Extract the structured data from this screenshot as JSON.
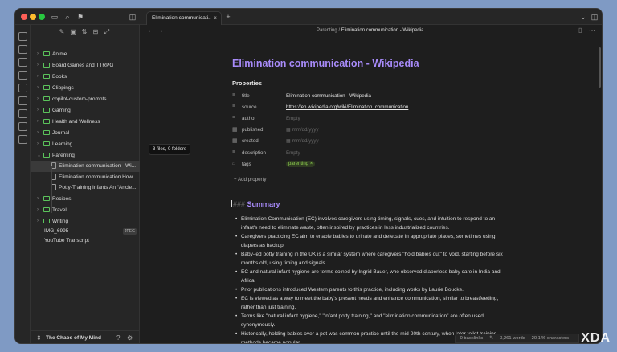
{
  "tab": {
    "title": "Elimination communicati..."
  },
  "breadcrumb": {
    "parent": "Parenting",
    "separator": "/",
    "current": "Elimination communication - Wikipedia"
  },
  "sidebar": {
    "items": [
      {
        "label": "Anime",
        "type": "folder",
        "level": 0,
        "expanded": false
      },
      {
        "label": "Board Games and TTRPG",
        "type": "folder",
        "level": 0,
        "expanded": false
      },
      {
        "label": "Books",
        "type": "folder",
        "level": 0,
        "expanded": false
      },
      {
        "label": "Clippings",
        "type": "folder",
        "level": 0,
        "expanded": false
      },
      {
        "label": "copilot-custom-prompts",
        "type": "folder",
        "level": 0,
        "expanded": false
      },
      {
        "label": "Gaming",
        "type": "folder",
        "level": 0,
        "expanded": false
      },
      {
        "label": "Health and Wellness",
        "type": "folder",
        "level": 0,
        "expanded": false
      },
      {
        "label": "Journal",
        "type": "folder",
        "level": 0,
        "expanded": false
      },
      {
        "label": "Learning",
        "type": "folder",
        "level": 0,
        "expanded": false
      },
      {
        "label": "Parenting",
        "type": "folder",
        "level": 0,
        "expanded": true
      },
      {
        "label": "Elimination communication - Wi...",
        "type": "file",
        "level": 1,
        "active": true
      },
      {
        "label": "Elimination communication How ...",
        "type": "file",
        "level": 1
      },
      {
        "label": "Potty-Training Infants An “Ancie...",
        "type": "file",
        "level": 1
      },
      {
        "label": "Recipes",
        "type": "folder",
        "level": 0,
        "expanded": false
      },
      {
        "label": "Travel",
        "type": "folder",
        "level": 0,
        "expanded": false
      },
      {
        "label": "Writing",
        "type": "folder",
        "level": 0,
        "expanded": false
      },
      {
        "label": "IMG_6995",
        "type": "plain",
        "level": 0,
        "badge": "JPEG"
      },
      {
        "label": "YouTube Transcript",
        "type": "plain",
        "level": 0
      }
    ],
    "vault_name": "The Chaos of My Mind"
  },
  "tooltip": "3 files, 0 folders",
  "document": {
    "title": "Elimination communication - Wikipedia",
    "properties_heading": "Properties",
    "properties": [
      {
        "icon": "list-icon",
        "key": "title",
        "value": "Elimination communication - Wikipedia",
        "kind": "text"
      },
      {
        "icon": "list-icon",
        "key": "source",
        "value": "https://en.wikipedia.org/wiki/Elimination_communication",
        "kind": "link"
      },
      {
        "icon": "list-icon",
        "key": "author",
        "value": "Empty",
        "kind": "empty"
      },
      {
        "icon": "calendar-icon",
        "key": "published",
        "value": "mm/dd/yyyy",
        "kind": "date"
      },
      {
        "icon": "calendar-icon",
        "key": "created",
        "value": "mm/dd/yyyy",
        "kind": "date"
      },
      {
        "icon": "list-icon",
        "key": "description",
        "value": "Empty",
        "kind": "empty"
      },
      {
        "icon": "tag-icon",
        "key": "tags",
        "value": "parenting",
        "kind": "tag"
      }
    ],
    "add_property": "Add property",
    "section_hash": "###",
    "section_title": "Summary",
    "bullets": [
      "Elimination Communication (EC) involves caregivers using timing, signals, cues, and intuition to respond to an infant's need to eliminate waste, often inspired by practices in less industrialized countries.",
      "Caregivers practicing EC aim to enable babies to urinate and defecate in appropriate places, sometimes using diapers as backup.",
      "Baby-led potty training in the UK is a similar system where caregivers \"hold babies out\" to void, starting before six months old, using timing and signals.",
      "EC and natural infant hygiene are terms coined by Ingrid Bauer, who observed diaperless baby care in India and Africa.",
      "Prior publications introduced Western parents to this practice, including works by Laurie Boucke.",
      "EC is viewed as a way to meet the baby's present needs and enhance communication, similar to breastfeeding, rather than just training.",
      "Terms like \"natural infant hygiene,\" \"infant potty training,\" and \"elimination communication\" are often used synonymously.",
      "Historically, holding babies over a pot was common practice until the mid-20th century, when later toilet training methods became popular."
    ]
  },
  "status": {
    "backlinks": "0 backlinks",
    "words": "3,261 words",
    "characters": "20,146 characters"
  },
  "watermark": "XDA"
}
